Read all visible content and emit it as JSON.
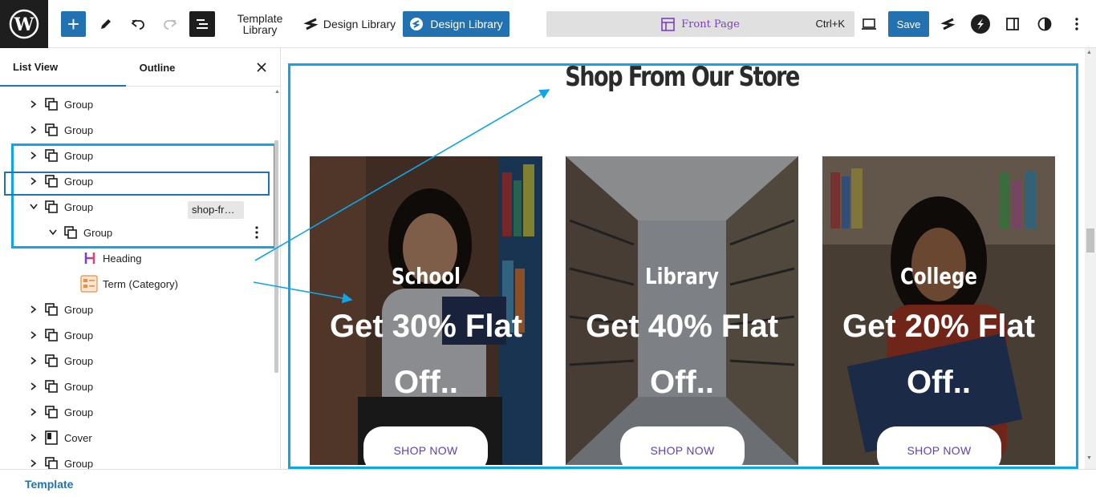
{
  "topbar": {
    "add_label": "+",
    "template_library_line1": "Template",
    "template_library_line2": "Library",
    "design_library_plain": "Design Library",
    "design_library_primary": "Design Library",
    "command_title": "Front Page",
    "command_shortcut": "Ctrl+K",
    "save_label": "Save"
  },
  "sidebar": {
    "tabs": [
      {
        "label": "List View"
      },
      {
        "label": "Outline"
      }
    ],
    "rows": [
      {
        "label": "Group"
      },
      {
        "label": "Group"
      },
      {
        "label": "Group"
      },
      {
        "label": "Group"
      },
      {
        "label": "Group"
      },
      {
        "label": "Group"
      },
      {
        "label": "Heading",
        "badge": "shop-fr…"
      },
      {
        "label": "Term (Category)"
      },
      {
        "label": "Group"
      },
      {
        "label": "Group"
      },
      {
        "label": "Group"
      },
      {
        "label": "Group"
      },
      {
        "label": "Group"
      },
      {
        "label": "Cover"
      },
      {
        "label": "Group"
      }
    ]
  },
  "canvas": {
    "heading": "Shop From Our Store",
    "cards": [
      {
        "title": "School",
        "offer_line1": "Get 30% Flat",
        "offer_line2": "Off..",
        "button": "SHOP NOW"
      },
      {
        "title": "Library",
        "offer_line1": "Get 40% Flat",
        "offer_line2": "Off..",
        "button": "SHOP NOW"
      },
      {
        "title": "College",
        "offer_line1": "Get 20% Flat",
        "offer_line2": "Off..",
        "button": "SHOP NOW"
      }
    ]
  },
  "footer": {
    "label": "Template"
  },
  "colors": {
    "accent": "#2271b1",
    "highlight": "#0ea5e9",
    "button_text": "#5b3fc7"
  }
}
